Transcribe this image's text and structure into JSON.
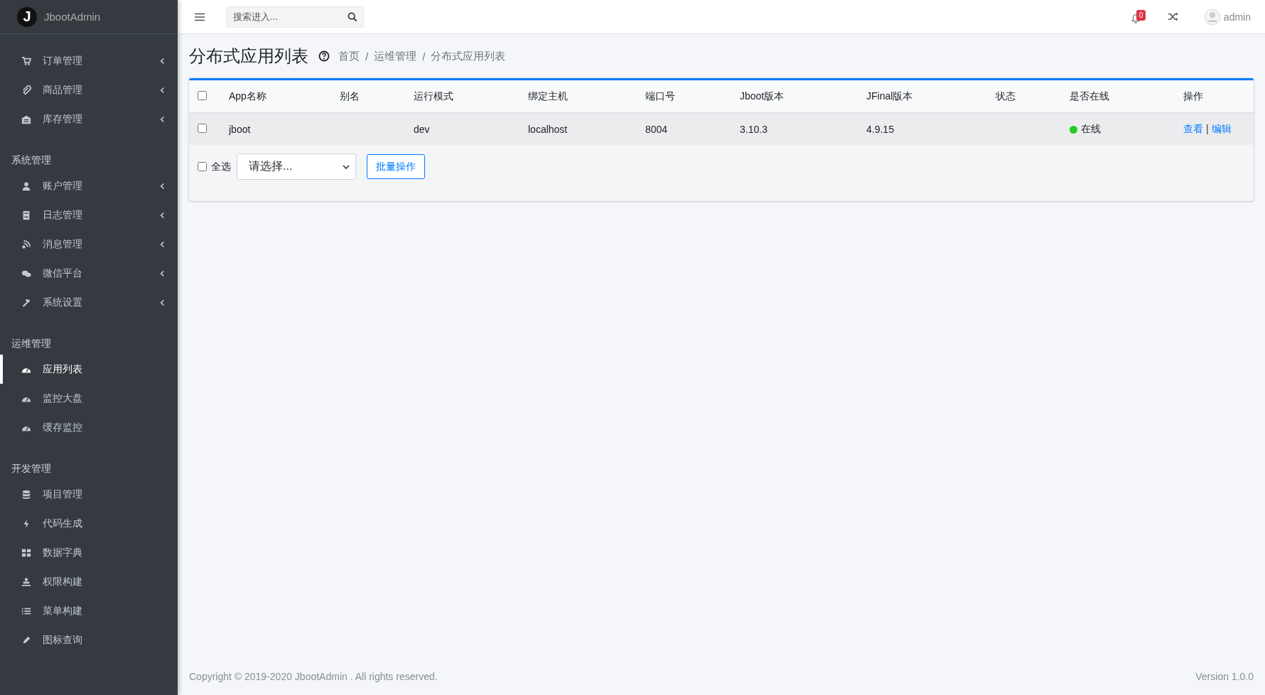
{
  "brand": {
    "logo_letter": "J",
    "name": "JbootAdmin"
  },
  "sidebar": {
    "groups": [
      {
        "items": [
          {
            "label": "订单管理",
            "selected": false,
            "has_submenu": true
          },
          {
            "label": "商品管理",
            "selected": false,
            "has_submenu": true
          },
          {
            "label": "库存管理",
            "selected": false,
            "has_submenu": true
          }
        ]
      },
      {
        "heading": "系统管理",
        "items": [
          {
            "label": "账户管理",
            "selected": false,
            "has_submenu": true
          },
          {
            "label": "日志管理",
            "selected": false,
            "has_submenu": true
          },
          {
            "label": "消息管理",
            "selected": false,
            "has_submenu": true
          },
          {
            "label": "微信平台",
            "selected": false,
            "has_submenu": true
          },
          {
            "label": "系统设置",
            "selected": false,
            "has_submenu": true
          }
        ]
      },
      {
        "heading": "运维管理",
        "items": [
          {
            "label": "应用列表",
            "selected": true,
            "has_submenu": false
          },
          {
            "label": "监控大盘",
            "selected": false,
            "has_submenu": false
          },
          {
            "label": "缓存监控",
            "selected": false,
            "has_submenu": false
          }
        ]
      },
      {
        "heading": "开发管理",
        "items": [
          {
            "label": "项目管理",
            "selected": false,
            "has_submenu": false
          },
          {
            "label": "代码生成",
            "selected": false,
            "has_submenu": false
          },
          {
            "label": "数据字典",
            "selected": false,
            "has_submenu": false
          },
          {
            "label": "权限构建",
            "selected": false,
            "has_submenu": false
          },
          {
            "label": "菜单构建",
            "selected": false,
            "has_submenu": false
          },
          {
            "label": "图标查询",
            "selected": false,
            "has_submenu": false
          }
        ]
      }
    ]
  },
  "topbar": {
    "search": {
      "placeholder": "搜索进入..."
    },
    "notification_count": "0",
    "user": "admin"
  },
  "page": {
    "title": "分布式应用列表",
    "breadcrumb": [
      "首页",
      "运维管理",
      "分布式应用列表"
    ],
    "breadcrumb_separator": "/"
  },
  "table": {
    "header_checked": false,
    "columns": [
      "App名称",
      "别名",
      "运行模式",
      "绑定主机",
      "端口号",
      "Jboot版本",
      "JFinal版本",
      "状态",
      "是否在线",
      "操作"
    ],
    "rows": [
      {
        "checked": false,
        "name": "jboot",
        "mode": "dev",
        "host": "localhost",
        "port": "8004",
        "jboot_version": "3.10.3",
        "jfinal_version": "4.9.15",
        "online": {
          "label": "在线",
          "color": "#22cc22"
        },
        "actions": [
          "查看",
          "编辑"
        ],
        "action_separator": "|"
      }
    ]
  },
  "bulk": {
    "select_all": {
      "label": "全选",
      "checked": false
    },
    "select_value": "请选择...",
    "button": "批量操作"
  },
  "footer": {
    "copyright": "Copyright © 2019-2020 JbootAdmin . All rights reserved.",
    "version": "Version 1.0.0"
  }
}
